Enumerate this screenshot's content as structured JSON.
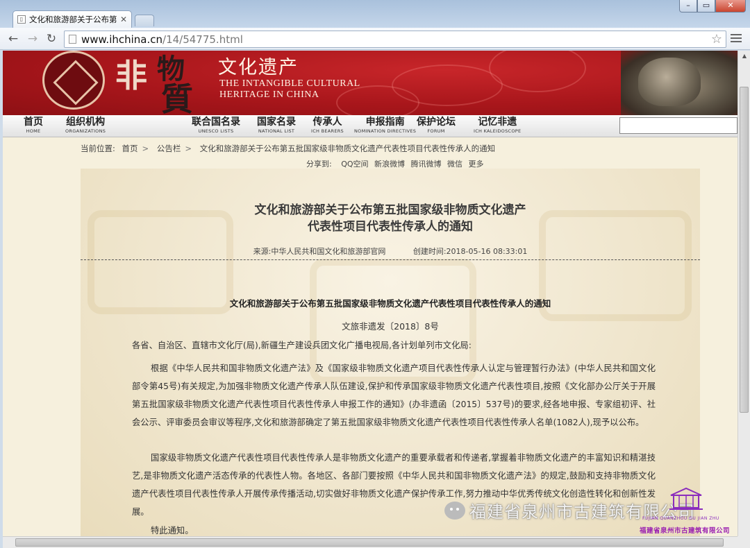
{
  "browser": {
    "tab_title": "文化和旅游部关于公布第五",
    "url_host": "www.ihchina.cn",
    "url_path": "/14/54775.html"
  },
  "site": {
    "banner_cn": "文化遗产",
    "banner_en_line1": "THE INTANGIBLE CULTURAL",
    "banner_en_line2": "HERITAGE IN CHINA",
    "calligraphy": [
      "非",
      "物",
      "質"
    ],
    "nav": [
      {
        "cn": "首页",
        "en": "HOME"
      },
      {
        "cn": "组织机构",
        "en": "ORGANIZATIONS"
      },
      {
        "cn": "联合国名录",
        "en": "UNESCO LISTS"
      },
      {
        "cn": "国家名录",
        "en": "NATIONAL LIST"
      },
      {
        "cn": "传承人",
        "en": "ICH BEARERS"
      },
      {
        "cn": "申报指南",
        "en": "NOMINATION DIRECTIVES"
      },
      {
        "cn": "保护论坛",
        "en": "FORUM"
      },
      {
        "cn": "记忆非遗",
        "en": "ICH KALEIDOSCOPE"
      }
    ]
  },
  "breadcrumb": {
    "label": "当前位置:",
    "items": [
      "首页",
      "公告栏",
      "文化和旅游部关于公布第五批国家级非物质文化遗产代表性项目代表性传承人的通知"
    ],
    "separator": ">"
  },
  "share": {
    "label": "分享到:",
    "items": [
      "QQ空间",
      "新浪微博",
      "腾讯微博",
      "微信",
      "更多"
    ]
  },
  "article": {
    "title_line1": "文化和旅游部关于公布第五批国家级非物质文化遗产",
    "title_line2": "代表性项目代表性传承人的通知",
    "source": "来源:中华人民共和国文化和旅游部官网",
    "created": "创建时间:2018-05-16 08:33:01",
    "doc_title": "文化和旅游部关于公布第五批国家级非物质文化遗产代表性项目代表性传承人的通知",
    "doc_no": "文旅非遗发〔2018〕8号",
    "addressee": "各省、自治区、直辖市文化厅(局),新疆生产建设兵团文化广播电视局,各计划单列市文化局:",
    "para1": "根据《中华人民共和国非物质文化遗产法》及《国家级非物质文化遗产项目代表性传承人认定与管理暂行办法》(中华人民共和国文化部令第45号)有关规定,为加强非物质文化遗产传承人队伍建设,保护和传承国家级非物质文化遗产代表性项目,按照《文化部办公厅关于开展第五批国家级非物质文化遗产代表性项目代表性传承人申报工作的通知》(办非遗函〔2015〕537号)的要求,经各地申报、专家组初评、社会公示、评审委员会审议等程序,文化和旅游部确定了第五批国家级非物质文化遗产代表性项目代表性传承人名单(1082人),现予以公布。",
    "para2": "国家级非物质文化遗产代表性项目代表性传承人是非物质文化遗产的重要承载者和传递者,掌握着非物质文化遗产的丰富知识和精湛技艺,是非物质文化遗产活态传承的代表性人物。各地区、各部门要按照《中华人民共和国非物质文化遗产法》的规定,鼓励和支持非物质文化遗产代表性项目代表性传承人开展传承传播活动,切实做好非物质文化遗产保护传承工作,努力推动中华优秀传统文化创造性转化和创新性发展。",
    "closing": "特此通知。"
  },
  "watermark": {
    "text": "福建省泉州市古建筑有限公司",
    "seal_en": "FUJIAN QUANZHOU GU JIAN ZHU",
    "seal_cn": "福建省泉州市古建筑有限公司"
  }
}
